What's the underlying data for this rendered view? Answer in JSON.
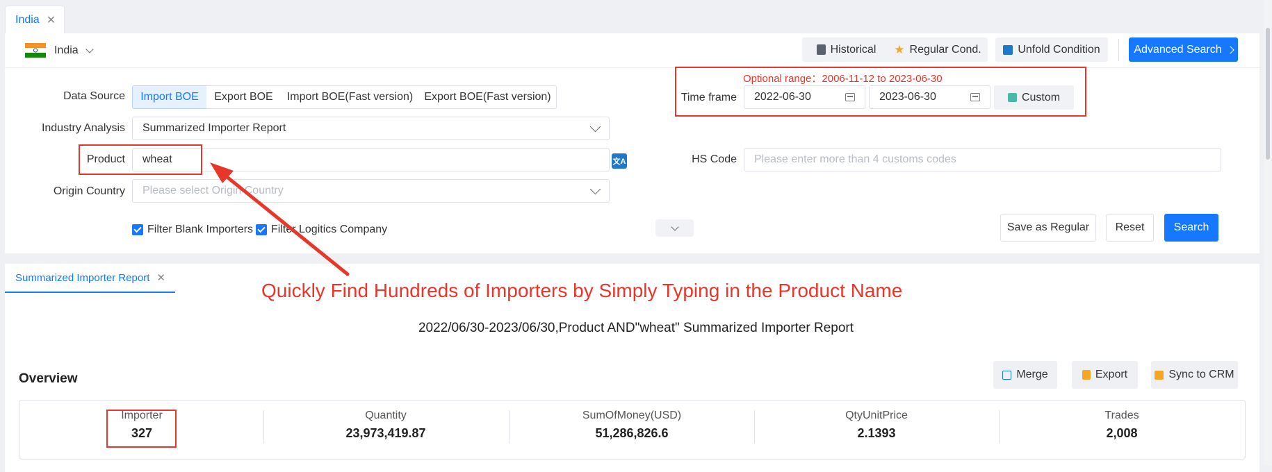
{
  "tab": {
    "label": "India"
  },
  "country": {
    "name": "India"
  },
  "toolbar": {
    "historical": "Historical",
    "regular_cond": "Regular Cond.",
    "unfold": "Unfold Condition",
    "advanced_search": "Advanced Search"
  },
  "form": {
    "data_source_label": "Data Source",
    "data_sources": [
      "Import BOE",
      "Export BOE",
      "Import BOE(Fast version)",
      "Export BOE(Fast version)"
    ],
    "data_source_selected": "Import BOE",
    "industry_label": "Industry Analysis",
    "industry_value": "Summarized Importer Report",
    "product_label": "Product",
    "product_value": "wheat",
    "origin_label": "Origin Country",
    "origin_placeholder": "Please select Origin Country",
    "filter_blank": "Filter Blank Importers",
    "filter_logistics": "Filter Logitics Company",
    "optional_range": "Optional range：2006-11-12 to 2023-06-30",
    "timeframe_label": "Time frame",
    "date_from": "2022-06-30",
    "date_to": "2023-06-30",
    "custom": "Custom",
    "hs_label": "HS Code",
    "hs_placeholder": "Please enter more than 4 customs codes",
    "save_regular": "Save as Regular",
    "reset": "Reset",
    "search": "Search"
  },
  "annotation": {
    "text": "Quickly Find Hundreds of Importers by Simply Typing in the Product Name"
  },
  "report": {
    "tab_label": "Summarized Importer Report",
    "title": "2022/06/30-2023/06/30,Product AND\"wheat\" Summarized Importer Report",
    "overview": "Overview",
    "merge": "Merge",
    "export": "Export",
    "sync": "Sync to CRM",
    "stats": [
      {
        "label": "Importer",
        "value": "327"
      },
      {
        "label": "Quantity",
        "value": "23,973,419.87"
      },
      {
        "label": "SumOfMoney(USD)",
        "value": "51,286,826.6"
      },
      {
        "label": "QtyUnitPrice",
        "value": "2.1393"
      },
      {
        "label": "Trades",
        "value": "2,008"
      }
    ]
  },
  "colors": {
    "primary": "#1677ff",
    "highlight_red": "#e8362a",
    "background": "#eef0f4"
  }
}
